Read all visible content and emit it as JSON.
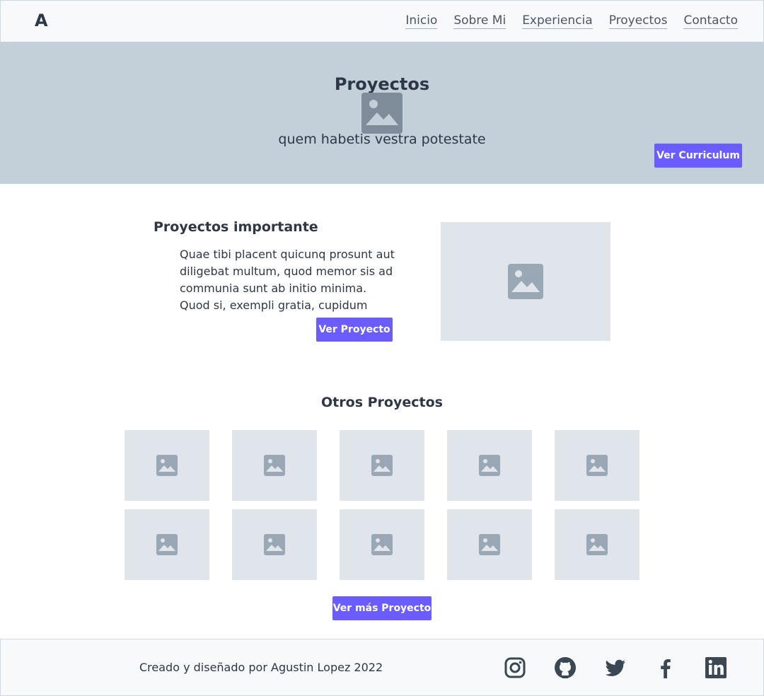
{
  "navbar": {
    "logo": "A",
    "links": [
      "Inicio",
      "Sobre Mi",
      "Experiencia",
      "Proyectos",
      "Contacto"
    ]
  },
  "hero": {
    "title": "Proyectos",
    "subtitle": "quem habetis vestra potestate",
    "cv_button": "Ver Curriculum"
  },
  "featured": {
    "title": "Proyectos importante",
    "description": "Quae tibi placent quicunq prosunt aut diligebat multum, quod memor sis ad communia sunt ab initio minima. Quod si, exempli gratia, cupidum rerum in",
    "button": "Ver Proyecto",
    "image_icon": "image-placeholder-icon"
  },
  "others": {
    "title": "Otros Proyectos",
    "thumbnail_count": 10,
    "button": "Ver más Proyecto"
  },
  "footer": {
    "text": "Creado y diseñado por Agustin Lopez 2022",
    "social_icons": [
      "instagram-icon",
      "github-icon",
      "twitter-icon",
      "facebook-icon",
      "linkedin-icon"
    ]
  },
  "colors": {
    "accent": "#6a5cff",
    "hero_bg": "#c3cfd9",
    "placeholder_bg": "#e0e5ec",
    "icon_gray": "#9aa7b4",
    "text_dark": "#2d3748"
  }
}
